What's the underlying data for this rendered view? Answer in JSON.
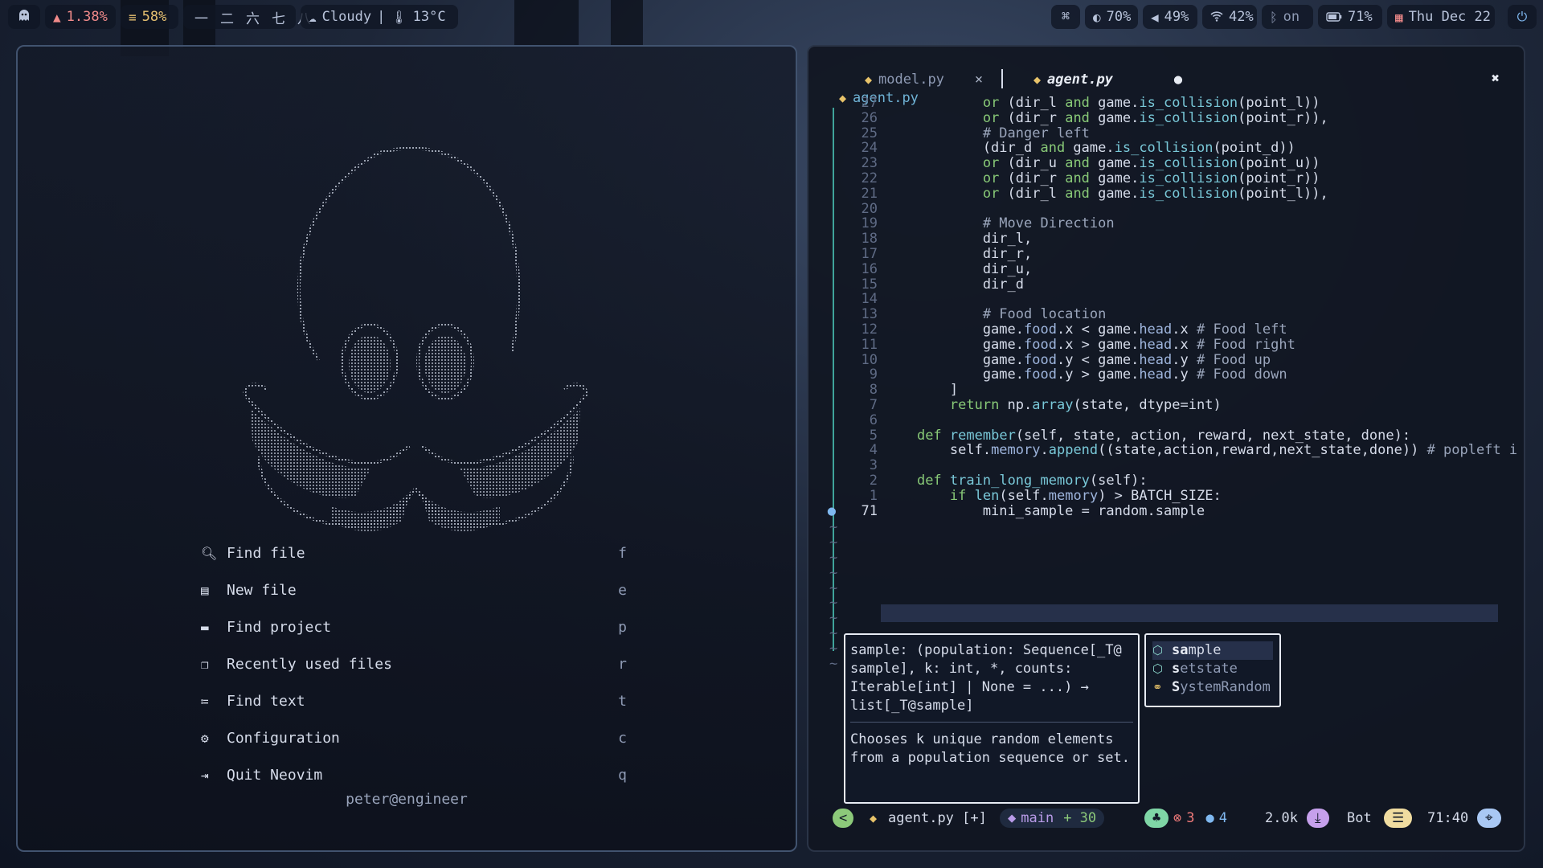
{
  "topbar": {
    "launcher_icon": "ghost-icon",
    "cpu": "1.38%",
    "memory": "58%",
    "workspaces": [
      "一",
      "二",
      "六",
      "七",
      "八"
    ],
    "weather": "Cloudy",
    "temperature": "13°C",
    "cmd_symbol": "⌘",
    "brightness": "70%",
    "volume": "49%",
    "wifi": "42%",
    "bluetooth": "on",
    "battery": "71%",
    "date": "Thu Dec 22",
    "power_icon": "power-icon"
  },
  "dashboard": {
    "menu": [
      {
        "icon": "find-file-icon",
        "label": "Find file",
        "key": "f"
      },
      {
        "icon": "new-file-icon",
        "label": "New file",
        "key": "e"
      },
      {
        "icon": "folder-icon",
        "label": "Find project",
        "key": "p"
      },
      {
        "icon": "recent-files-icon",
        "label": "Recently used files",
        "key": "r"
      },
      {
        "icon": "find-text-icon",
        "label": "Find text",
        "key": "t"
      },
      {
        "icon": "gear-icon",
        "label": "Configuration",
        "key": "c"
      },
      {
        "icon": "quit-icon",
        "label": "Quit Neovim",
        "key": "q"
      }
    ],
    "footer": "peter@engineer"
  },
  "editor": {
    "tabs": [
      {
        "name": "model.py",
        "active": false,
        "close": "×"
      },
      {
        "name": "agent.py",
        "active": true,
        "modified": "●"
      }
    ],
    "close_window": "✖",
    "winbar": "agent.py",
    "lines": [
      {
        "n": "27",
        "t": "            or (dir_l and game.is_collision(point_l))"
      },
      {
        "n": "26",
        "t": "            or (dir_r and game.is_collision(point_r)),"
      },
      {
        "n": "25",
        "t": "            # Danger left"
      },
      {
        "n": "24",
        "t": "            (dir_d and game.is_collision(point_d))"
      },
      {
        "n": "23",
        "t": "            or (dir_u and game.is_collision(point_u))"
      },
      {
        "n": "22",
        "t": "            or (dir_r and game.is_collision(point_r))"
      },
      {
        "n": "21",
        "t": "            or (dir_l and game.is_collision(point_l)),"
      },
      {
        "n": "20",
        "t": ""
      },
      {
        "n": "19",
        "t": "            # Move Direction"
      },
      {
        "n": "18",
        "t": "            dir_l,"
      },
      {
        "n": "17",
        "t": "            dir_r,"
      },
      {
        "n": "16",
        "t": "            dir_u,"
      },
      {
        "n": "15",
        "t": "            dir_d"
      },
      {
        "n": "14",
        "t": ""
      },
      {
        "n": "13",
        "t": "            # Food location"
      },
      {
        "n": "12",
        "t": "            game.food.x < game.head.x # Food left"
      },
      {
        "n": "11",
        "t": "            game.food.x > game.head.x # Food right"
      },
      {
        "n": "10",
        "t": "            game.food.y < game.head.y # Food up"
      },
      {
        "n": "9",
        "t": "            game.food.y > game.head.y # Food down"
      },
      {
        "n": "8",
        "t": "        ]"
      },
      {
        "n": "7",
        "t": "        return np.array(state, dtype=int)"
      },
      {
        "n": "6",
        "t": ""
      },
      {
        "n": "5",
        "t": "    def remember(self, state, action, reward, next_state, done):"
      },
      {
        "n": "4",
        "t": "        self.memory.append((state,action,reward,next_state,done)) # popleft i"
      },
      {
        "n": "3",
        "t": ""
      },
      {
        "n": "2",
        "t": "    def train_long_memory(self):"
      },
      {
        "n": "1",
        "t": "        if len(self.memory) > BATCH_SIZE:"
      },
      {
        "n": "71",
        "t": "            mini_sample = random.sample"
      }
    ],
    "signature_lines": [
      "sample: (population: Sequence[_T@",
      "sample], k: int, *, counts:",
      "Iterable[int] | None = ...) →",
      "list[_T@sample]"
    ],
    "signature_doc": [
      "Chooses k unique random elements",
      "from a population sequence or set."
    ],
    "completions": [
      {
        "pre": "",
        "match": "sa",
        "rest": "mple",
        "icon": "method-icon"
      },
      {
        "pre": "",
        "match": "s",
        "rest": "etstate",
        "icon": "method-icon"
      },
      {
        "pre": "",
        "match": "S",
        "rest": "ystemRandom",
        "icon": "class-icon"
      }
    ],
    "statusline": {
      "mode": "<",
      "file": "agent.py [+]",
      "branch": "main",
      "added": "+ 30",
      "errors": "3",
      "hints": "4",
      "size": "2.0k",
      "position_label": "Bot",
      "cursor": "71:40"
    }
  }
}
